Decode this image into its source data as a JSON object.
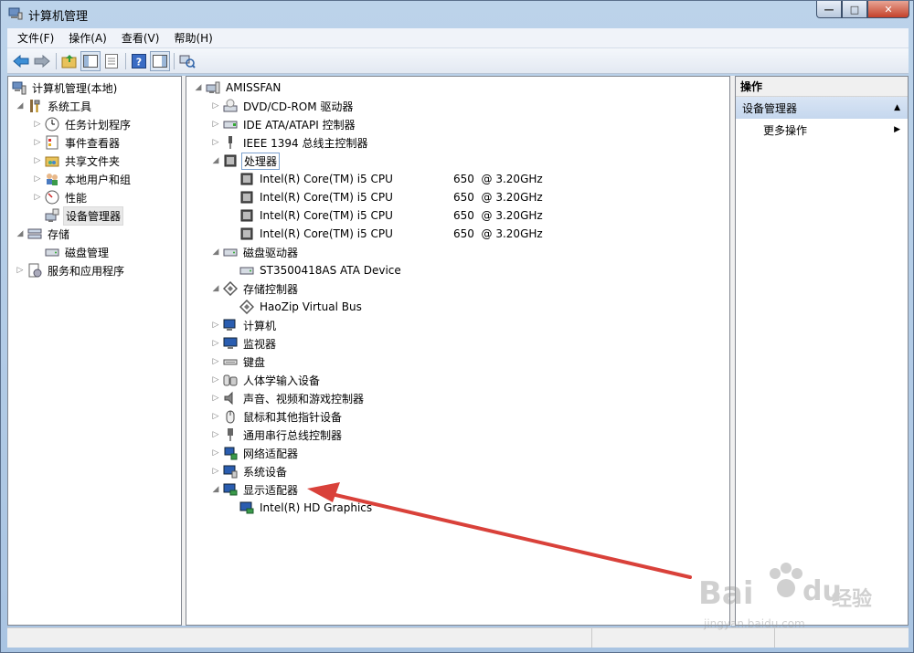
{
  "window": {
    "title": "计算机管理",
    "minimize_glyph": "—",
    "maximize_glyph": "□",
    "close_glyph": "✕"
  },
  "menu": [
    "文件(F)",
    "操作(A)",
    "查看(V)",
    "帮助(H)"
  ],
  "left_tree": {
    "root": "计算机管理(本地)",
    "system_tools": "系统工具",
    "task_scheduler": "任务计划程序",
    "event_viewer": "事件查看器",
    "shared_folders": "共享文件夹",
    "local_users": "本地用户和组",
    "performance": "性能",
    "device_manager": "设备管理器",
    "storage": "存储",
    "disk_management": "磁盘管理",
    "services_apps": "服务和应用程序"
  },
  "devices": {
    "root": "AMISSFAN",
    "dvd": "DVD/CD-ROM 驱动器",
    "ide": "IDE ATA/ATAPI 控制器",
    "ieee1394": "IEEE 1394 总线主控制器",
    "processors": "处理器",
    "cpus": [
      {
        "name": "Intel(R) Core(TM) i5 CPU",
        "speed": "650  @ 3.20GHz"
      },
      {
        "name": "Intel(R) Core(TM) i5 CPU",
        "speed": "650  @ 3.20GHz"
      },
      {
        "name": "Intel(R) Core(TM) i5 CPU",
        "speed": "650  @ 3.20GHz"
      },
      {
        "name": "Intel(R) Core(TM) i5 CPU",
        "speed": "650  @ 3.20GHz"
      }
    ],
    "disk_drives": "磁盘驱动器",
    "disk_device": "ST3500418AS ATA Device",
    "storage_controllers": "存储控制器",
    "haozip": "HaoZip Virtual Bus",
    "computer": "计算机",
    "monitors": "监视器",
    "keyboards": "键盘",
    "hid": "人体学输入设备",
    "sound": "声音、视频和游戏控制器",
    "mice": "鼠标和其他指针设备",
    "usb": "通用串行总线控制器",
    "network": "网络适配器",
    "system": "系统设备",
    "display": "显示适配器",
    "display_device": "Intel(R) HD Graphics"
  },
  "actions": {
    "header": "操作",
    "section": "设备管理器",
    "more": "更多操作"
  },
  "watermark": {
    "brand": "Bai",
    "brand2": "du",
    "cn": "经验",
    "url": "jingyan.baidu.com"
  },
  "colors": {
    "annotation_arrow": "#d9413a",
    "selection": "#7da2ce"
  }
}
